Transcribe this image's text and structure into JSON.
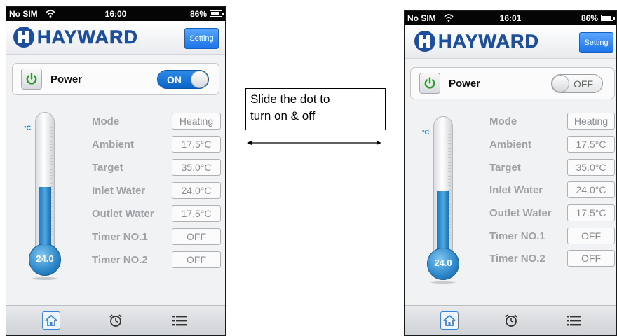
{
  "annotation": {
    "text_line1": "Slide the dot to",
    "text_line2": "turn on & off"
  },
  "screens": [
    {
      "status": {
        "carrier": "No SIM",
        "time": "16:00",
        "battery": "86%"
      },
      "header": {
        "brand": "HAYWARD",
        "setting_label": "Setting"
      },
      "power": {
        "label": "Power",
        "state": "ON",
        "on": true
      },
      "thermometer": {
        "unit": "°C",
        "reading": "24.0",
        "fill_fraction": 0.48
      },
      "rows": [
        {
          "label": "Mode",
          "value": "Heating"
        },
        {
          "label": "Ambient",
          "value": "17.5°C"
        },
        {
          "label": "Target",
          "value": "35.0°C"
        },
        {
          "label": "Inlet Water",
          "value": "24.0°C"
        },
        {
          "label": "Outlet Water",
          "value": "17.5°C"
        },
        {
          "label": "Timer NO.1",
          "value": "OFF"
        },
        {
          "label": "Timer NO.2",
          "value": "OFF"
        }
      ],
      "tabs": [
        "home-icon",
        "alarm-clock-icon",
        "list-icon"
      ]
    },
    {
      "status": {
        "carrier": "No SIM",
        "time": "16:01",
        "battery": "86%"
      },
      "header": {
        "brand": "HAYWARD",
        "setting_label": "Setting"
      },
      "power": {
        "label": "Power",
        "state": "OFF",
        "on": false
      },
      "thermometer": {
        "unit": "°C",
        "reading": "24.0",
        "fill_fraction": 0.48
      },
      "rows": [
        {
          "label": "Mode",
          "value": "Heating"
        },
        {
          "label": "Ambient",
          "value": "17.5°C"
        },
        {
          "label": "Target",
          "value": "35.0°C"
        },
        {
          "label": "Inlet Water",
          "value": "24.0°C"
        },
        {
          "label": "Outlet Water",
          "value": "17.5°C"
        },
        {
          "label": "Timer NO.1",
          "value": "OFF"
        },
        {
          "label": "Timer NO.2",
          "value": "OFF"
        }
      ],
      "tabs": [
        "home-icon",
        "alarm-clock-icon",
        "list-icon"
      ]
    }
  ],
  "colors": {
    "brand": "#1d4f9b",
    "accent": "#1a73e8",
    "thermo_fill": "#3a93d3"
  }
}
